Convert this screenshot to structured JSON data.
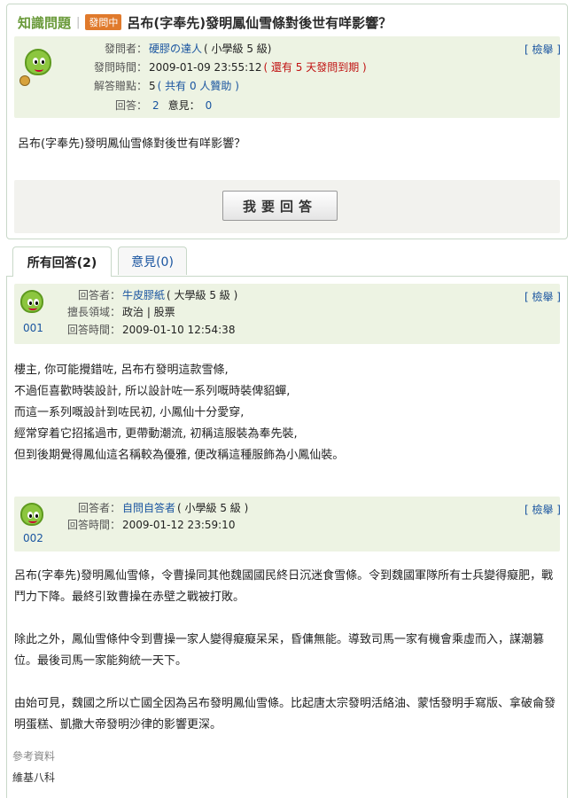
{
  "header": {
    "brand": "知識問題",
    "separator": "|",
    "status": "發問中",
    "title": "呂布(字奉先)發明鳳仙雪條對後世有咩影響？"
  },
  "question": {
    "asker_label": "發問者：",
    "asker_name": "硬膠の達人",
    "asker_level": "( 小學級 5 級)",
    "time_label": "發問時間：",
    "time_value": "2009-01-09 23:55:12",
    "deadline": "( 還有 5 天發問到期 )",
    "points_label": "解答贈點：",
    "points_value": "5",
    "sponsor": "( 共有 0 人贊助 )",
    "answers_label": "回答：",
    "answers_count": "2",
    "comments_label": "意見：",
    "comments_count": "0",
    "report": "[ 檢舉 ]",
    "body": "呂布(字奉先)發明鳳仙雪條對後世有咩影響？",
    "answer_button": "我要回答"
  },
  "tabs": [
    {
      "label": "所有回答(2)"
    },
    {
      "label": "意見(0)"
    }
  ],
  "answers": [
    {
      "number": "001",
      "answerer_label": "回答者：",
      "answerer_name": "牛皮膠紙",
      "answerer_level": "( 大學級 5 級 )",
      "expertise_label": "擅長領域：",
      "expertise_value": "政治 | 股票",
      "time_label": "回答時間：",
      "time_value": "2009-01-10 12:54:38",
      "report": "[ 檢舉 ]",
      "lines": [
        "樓主, 你可能攪錯咗, 呂布冇發明這款雪條,",
        "不過佢喜歡時裝設計, 所以設計咗一系列嘅時裝俾貂蟬,",
        "而這一系列嘅設計到咗民初, 小鳳仙十分愛穿,",
        "經常穿着它招搖過市, 更帶動潮流, 初稱這服裝為奉先裝,",
        "但到後期覺得鳳仙這名稱較為優雅, 便改稱這種服飾為小鳳仙裝。"
      ]
    },
    {
      "number": "002",
      "answerer_label": "回答者：",
      "answerer_name": "自問自答者",
      "answerer_level": "( 小學級 5 級 )",
      "time_label": "回答時間：",
      "time_value": "2009-01-12 23:59:10",
      "report": "[ 檢舉 ]",
      "paragraphs": [
        "呂布(字奉先)發明鳳仙雪條，令曹操同其他魏國國民終日沉迷食雪條。令到魏國軍隊所有士兵變得癡肥，戰鬥力下降。最終引致曹操在赤壁之戰被打敗。",
        "除此之外，鳳仙雪條仲令到曹操一家人變得癡癡呆呆，昏傭無能。導致司馬一家有機會乘虛而入，謀潮篡位。最後司馬一家能夠統一天下。",
        "由始可見，魏國之所以亡國全因為呂布發明鳳仙雪條。比起唐太宗發明活絡油、蒙恬發明手寫版、拿破侖發明蛋糕、凱撒大帝發明沙律的影響更深。"
      ],
      "reference_label": "參考資料",
      "reference_value": "維基八科"
    }
  ]
}
